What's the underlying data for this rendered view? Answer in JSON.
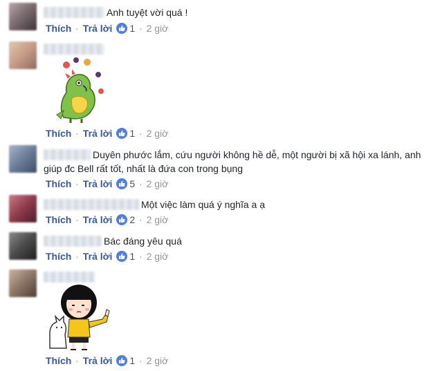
{
  "actions": {
    "like": "Thích",
    "reply": "Trả lời",
    "separator": "·"
  },
  "comments": [
    {
      "text": "Anh tuyệt vời quá !",
      "reactions": "1",
      "time": "2 giờ",
      "sticker": ""
    },
    {
      "text": "",
      "reactions": "1",
      "time": "2 giờ",
      "sticker": "dinosaur-juggling-sticker"
    },
    {
      "text": "Duyên phước lắm, cứu người không hề dễ, một người bị xã hội xa lánh, anh giúp đc Bell rất tốt, nhất là đứa con trong bụng",
      "reactions": "5",
      "time": "2 giờ",
      "sticker": ""
    },
    {
      "text": "Một việc làm quá ý nghĩa a ạ",
      "reactions": "2",
      "time": "2 giờ",
      "sticker": ""
    },
    {
      "text": "Bác đáng yêu quá",
      "reactions": "1",
      "time": "2 giờ",
      "sticker": ""
    },
    {
      "text": "",
      "reactions": "1",
      "time": "2 giờ",
      "sticker": "girl-thumbs-up-sticker"
    }
  ],
  "colors": {
    "link": "#365899",
    "like_badge": "#4e7de5",
    "meta": "#90949c"
  }
}
